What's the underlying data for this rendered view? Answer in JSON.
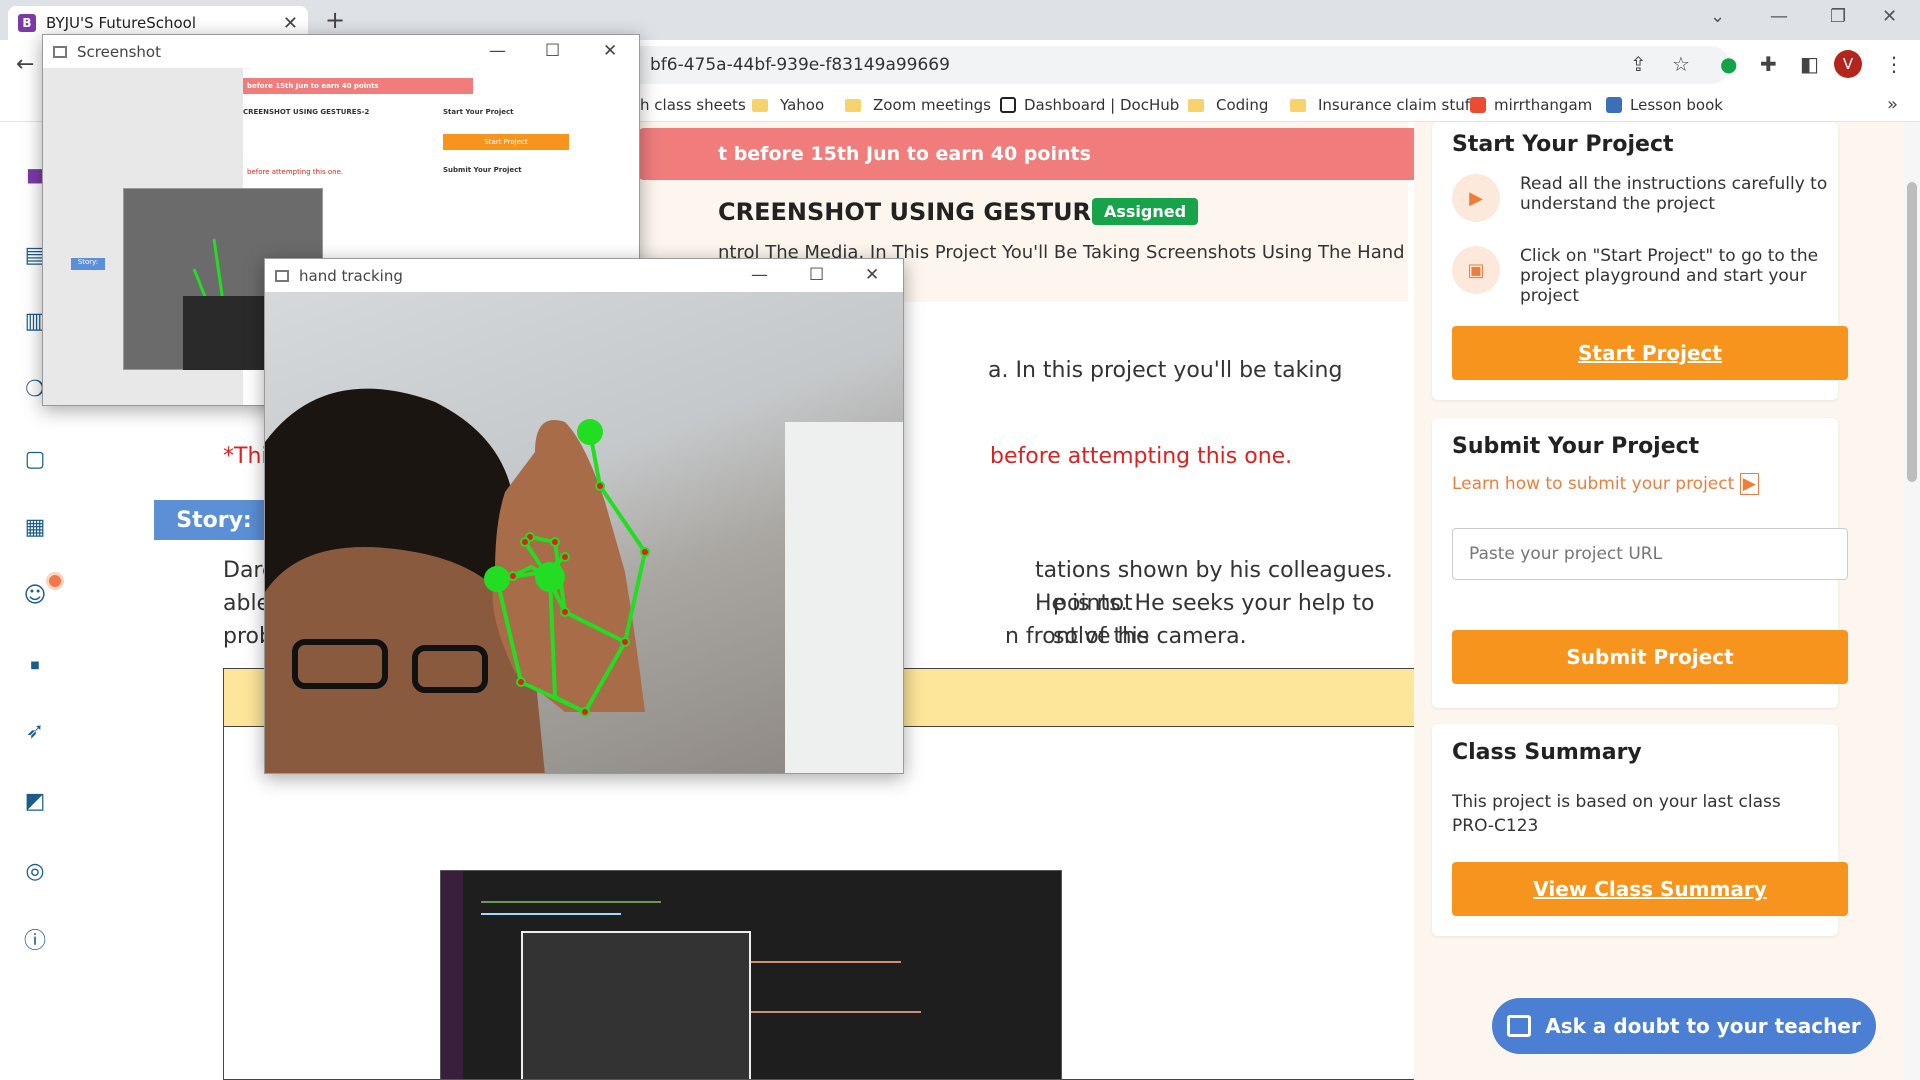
{
  "browser": {
    "tab_title": "BYJU'S FutureSchool",
    "url": "bf6-475a-44bf-939e-f83149a99669",
    "profile_initial": "V",
    "bookmarks": [
      "h class sheets",
      "Yahoo",
      "Zoom meetings",
      "Dashboard | DocHub",
      "Coding",
      "Insurance claim stuff",
      "mirrthangam",
      "Lesson book"
    ]
  },
  "page": {
    "banner": "t before 15th Jun to earn 40 points",
    "title": "CREENSHOT USING GESTURES-2",
    "badge": "Assigned",
    "subtitle": "ntrol The Media. In This Project You'll Be Taking Screenshots Using The Hand Gestures.",
    "para1": "a. In this project you'll be taking",
    "warn_start": "*This is a c",
    "warn_end": "before attempting this one.",
    "story_label": "Story:",
    "story_line1_start": "Daren is w",
    "story_line1_end": "tations shown by his colleagues. He is not",
    "story_line2_start": "able to cop",
    "story_line2_end": "points. He seeks your help to solve his",
    "story_line3_start": "problem by",
    "story_line3_end": "n front of the camera."
  },
  "sidebar": {
    "start": {
      "heading": "Start Your Project",
      "step1": "Read all the instructions carefully to understand the project",
      "step2": "Click on \"Start Project\" to go to the project playground and start your project",
      "button": "Start Project"
    },
    "submit": {
      "heading": "Submit Your Project",
      "learn": "Learn how to submit your project",
      "placeholder": "Paste your project URL",
      "button": "Submit Project"
    },
    "summary": {
      "heading": "Class Summary",
      "text": "This project is based on your last class PRO-C123",
      "button": "View Class Summary"
    },
    "ask": "Ask a doubt to your teacher"
  },
  "windows": {
    "screenshot_title": "Screenshot",
    "tracking_title": "hand tracking",
    "mini_banner": "before 15th Jun to earn 40 points",
    "mini_title": "CREENSHOT USING GESTURES-2",
    "mini_start": "Start Project",
    "mini_submit": "Submit Your Project",
    "mini_story": "Story:"
  }
}
